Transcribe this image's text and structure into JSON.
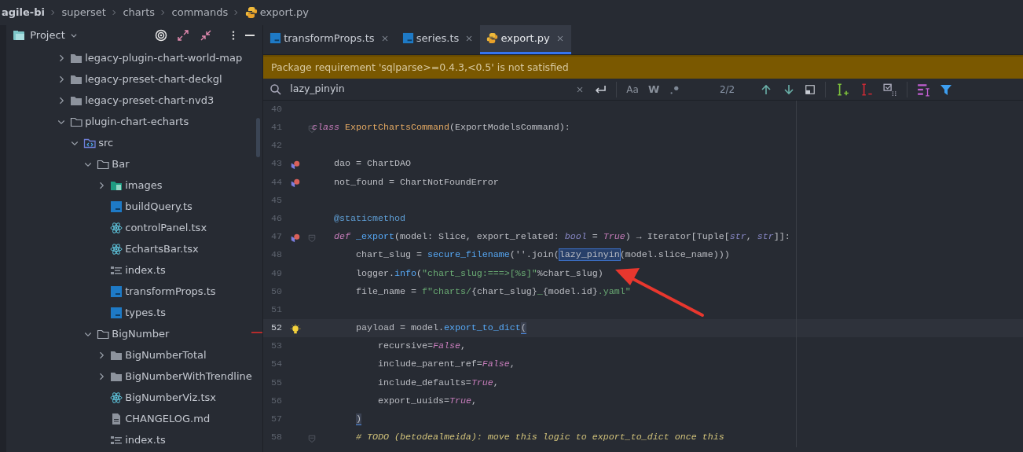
{
  "breadcrumb": [
    {
      "label": "agile-bi",
      "kind": "root"
    },
    {
      "label": "superset",
      "kind": "dir"
    },
    {
      "label": "charts",
      "kind": "dir"
    },
    {
      "label": "commands",
      "kind": "dir"
    },
    {
      "label": "export.py",
      "kind": "python"
    }
  ],
  "project_panel": {
    "title": "Project",
    "tree": [
      {
        "label": "legacy-plugin-chart-world-map",
        "kind": "folder",
        "expanded": false
      },
      {
        "label": "legacy-preset-chart-deckgl",
        "kind": "folder",
        "expanded": false
      },
      {
        "label": "legacy-preset-chart-nvd3",
        "kind": "folder",
        "expanded": false
      },
      {
        "label": "plugin-chart-echarts",
        "kind": "folder",
        "expanded": true,
        "children": [
          {
            "label": "src",
            "kind": "source",
            "expanded": true,
            "children": [
              {
                "label": "Bar",
                "kind": "folder",
                "expanded": true,
                "children": [
                  {
                    "label": "images",
                    "kind": "images",
                    "expanded": false
                  },
                  {
                    "label": "buildQuery.ts",
                    "kind": "ts"
                  },
                  {
                    "label": "controlPanel.tsx",
                    "kind": "react"
                  },
                  {
                    "label": "EchartsBar.tsx",
                    "kind": "react"
                  },
                  {
                    "label": "index.ts",
                    "kind": "index"
                  },
                  {
                    "label": "transformProps.ts",
                    "kind": "ts"
                  },
                  {
                    "label": "types.ts",
                    "kind": "ts"
                  }
                ]
              },
              {
                "label": "BigNumber",
                "kind": "folder",
                "expanded": true,
                "children": [
                  {
                    "label": "BigNumberTotal",
                    "kind": "folder",
                    "expanded": false
                  },
                  {
                    "label": "BigNumberWithTrendline",
                    "kind": "folder",
                    "expanded": false
                  },
                  {
                    "label": "BigNumberViz.tsx",
                    "kind": "react"
                  },
                  {
                    "label": "CHANGELOG.md",
                    "kind": "md"
                  },
                  {
                    "label": "index.ts",
                    "kind": "index"
                  }
                ]
              }
            ]
          }
        ]
      }
    ]
  },
  "tabs": [
    {
      "label": "transformProps.ts",
      "kind": "ts",
      "selected": false
    },
    {
      "label": "series.ts",
      "kind": "ts",
      "selected": false
    },
    {
      "label": "export.py",
      "kind": "python",
      "selected": true
    }
  ],
  "banner": "Package requirement 'sqlparse>=0.4.3,<0.5' is not satisfied",
  "search": {
    "value": "lazy_pinyin",
    "case_label": "Aa",
    "word_label": "W",
    "count": "2/2"
  },
  "code": [
    {
      "number": "40"
    },
    {
      "number": "41",
      "fold": true,
      "tokens": [
        {
          "t": "class ",
          "kind": "kw"
        },
        {
          "t": "ExportChartsCommand",
          "kind": "cls"
        },
        {
          "t": "(ExportModelsCommand):",
          "kind": "p"
        }
      ]
    },
    {
      "number": "42"
    },
    {
      "number": "43",
      "override": true,
      "tokens": [
        {
          "t": "    dao = ChartDAO",
          "kind": "p"
        }
      ]
    },
    {
      "number": "44",
      "override": true,
      "tokens": [
        {
          "t": "    not_found = ChartNotFoundError",
          "kind": "p"
        }
      ]
    },
    {
      "number": "45"
    },
    {
      "number": "46",
      "tokens": [
        {
          "t": "    @staticmethod",
          "kind": "deco"
        }
      ]
    },
    {
      "number": "47",
      "override": true,
      "fold": true,
      "tokens": [
        {
          "t": "    def ",
          "kind": "kw"
        },
        {
          "t": "_export",
          "kind": "fn"
        },
        {
          "t": "(model: Slice, export_related: ",
          "kind": "p"
        },
        {
          "t": "bool",
          "kind": "bi"
        },
        {
          "t": " = ",
          "kind": "p"
        },
        {
          "t": "True",
          "kind": "const"
        },
        {
          "t": ") → Iterator[Tuple[",
          "kind": "p"
        },
        {
          "t": "str",
          "kind": "bi"
        },
        {
          "t": ", ",
          "kind": "p"
        },
        {
          "t": "str",
          "kind": "bi"
        },
        {
          "t": "]]:",
          "kind": "p"
        }
      ]
    },
    {
      "number": "48",
      "tokens": [
        {
          "t": "        chart_slug = ",
          "kind": "p"
        },
        {
          "t": "secure_filename",
          "kind": "fn"
        },
        {
          "t": "(''.join(",
          "kind": "p"
        },
        {
          "t": "lazy_pinyin",
          "kind": "match"
        },
        {
          "t": "(model.slice_name)))",
          "kind": "p"
        }
      ]
    },
    {
      "number": "49",
      "tokens": [
        {
          "t": "        logger.",
          "kind": "p"
        },
        {
          "t": "info",
          "kind": "fn"
        },
        {
          "t": "(",
          "kind": "p"
        },
        {
          "t": "\"chart_slug:===>[%s]\"",
          "kind": "str"
        },
        {
          "t": "%chart_slug)",
          "kind": "p"
        }
      ]
    },
    {
      "number": "50",
      "tokens": [
        {
          "t": "        file_name = ",
          "kind": "p"
        },
        {
          "t": "f\"charts/",
          "kind": "str"
        },
        {
          "t": "{chart_slug}",
          "kind": "p"
        },
        {
          "t": "_",
          "kind": "str"
        },
        {
          "t": "{model.id}",
          "kind": "p"
        },
        {
          "t": ".yaml\"",
          "kind": "str"
        }
      ]
    },
    {
      "number": "51"
    },
    {
      "number": "52",
      "current": true,
      "bulb": true,
      "tokens": [
        {
          "t": "        payload = model.",
          "kind": "p"
        },
        {
          "t": "export_to_dict",
          "kind": "fn"
        },
        {
          "t": "(",
          "kind": "brace"
        }
      ]
    },
    {
      "number": "53",
      "tokens": [
        {
          "t": "            recursive=",
          "kind": "p"
        },
        {
          "t": "False",
          "kind": "const"
        },
        {
          "t": ",",
          "kind": "p"
        }
      ]
    },
    {
      "number": "54",
      "tokens": [
        {
          "t": "            include_parent_ref=",
          "kind": "p"
        },
        {
          "t": "False",
          "kind": "const"
        },
        {
          "t": ",",
          "kind": "p"
        }
      ]
    },
    {
      "number": "55",
      "tokens": [
        {
          "t": "            include_defaults=",
          "kind": "p"
        },
        {
          "t": "True",
          "kind": "const"
        },
        {
          "t": ",",
          "kind": "p"
        }
      ]
    },
    {
      "number": "56",
      "tokens": [
        {
          "t": "            export_uuids=",
          "kind": "p"
        },
        {
          "t": "True",
          "kind": "const"
        },
        {
          "t": ",",
          "kind": "p"
        }
      ]
    },
    {
      "number": "57",
      "tokens": [
        {
          "t": "        )",
          "kind": "brace"
        }
      ]
    },
    {
      "number": "58",
      "fold": true,
      "tokens": [
        {
          "t": "        # TODO (betodealmeida): move this logic to export_to_dict once this",
          "kind": "cmt"
        }
      ]
    }
  ]
}
